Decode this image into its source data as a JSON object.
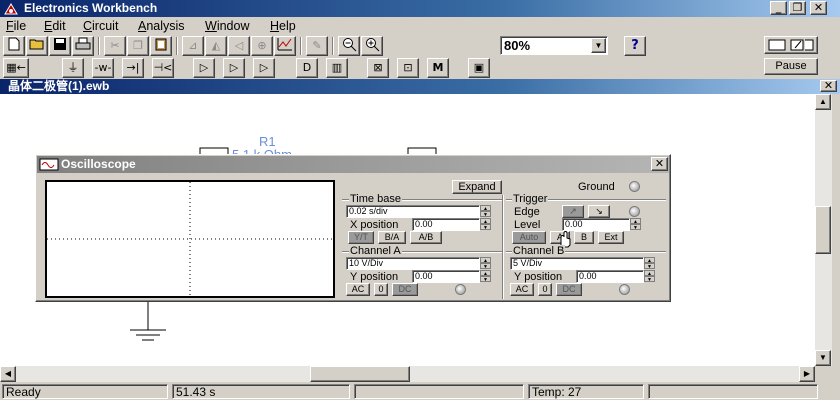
{
  "app": {
    "title": "Electronics Workbench"
  },
  "window_buttons": {
    "minimize": "_",
    "restore": "❐",
    "close": "✕"
  },
  "menu": [
    {
      "label": "File",
      "key": "F",
      "rest": "ile"
    },
    {
      "label": "Edit",
      "key": "E",
      "rest": "dit"
    },
    {
      "label": "Circuit",
      "key": "C",
      "rest": "ircuit"
    },
    {
      "label": "Analysis",
      "key": "A",
      "rest": "nalysis"
    },
    {
      "label": "Window",
      "key": "W",
      "rest": "indow"
    },
    {
      "label": "Help",
      "key": "H",
      "rest": "elp"
    }
  ],
  "toolbar": {
    "zoom_value": "80%",
    "help_label": "?",
    "pause_label": "Pause",
    "parts_m_label": "M"
  },
  "document": {
    "title": "晶体二极管(1).ewb"
  },
  "circuit": {
    "resistor_name": "R1",
    "resistor_value": "5.1 k Ohm"
  },
  "oscilloscope": {
    "title": "Oscilloscope",
    "expand_label": "Expand",
    "ground_label": "Ground",
    "time_base": {
      "heading": "Time base",
      "value": "0.02 s/div",
      "x_position_label": "X position",
      "x_position_value": "0.00",
      "modes": [
        "Y/T",
        "B/A",
        "A/B"
      ]
    },
    "trigger": {
      "heading": "Trigger",
      "edge_label": "Edge",
      "level_label": "Level",
      "level_value": "0.00",
      "sources": [
        "Auto",
        "A",
        "B",
        "Ext"
      ]
    },
    "channel_a": {
      "heading": "Channel A",
      "value": "10 V/Div",
      "y_position_label": "Y position",
      "y_position_value": "0.00",
      "coupling": [
        "AC",
        "0",
        "DC"
      ]
    },
    "channel_b": {
      "heading": "Channel B",
      "value": "5 V/Div",
      "y_position_label": "Y position",
      "y_position_value": "0.00",
      "coupling": [
        "AC",
        "0",
        "DC"
      ]
    }
  },
  "status": {
    "ready": "Ready",
    "time": "51.43 s",
    "temp": "Temp:  27"
  },
  "colors": {
    "title_active": "#0a246a",
    "title_inactive": "#808080",
    "face": "#d4d0c8",
    "wire_blue": "#6a8fd8"
  }
}
